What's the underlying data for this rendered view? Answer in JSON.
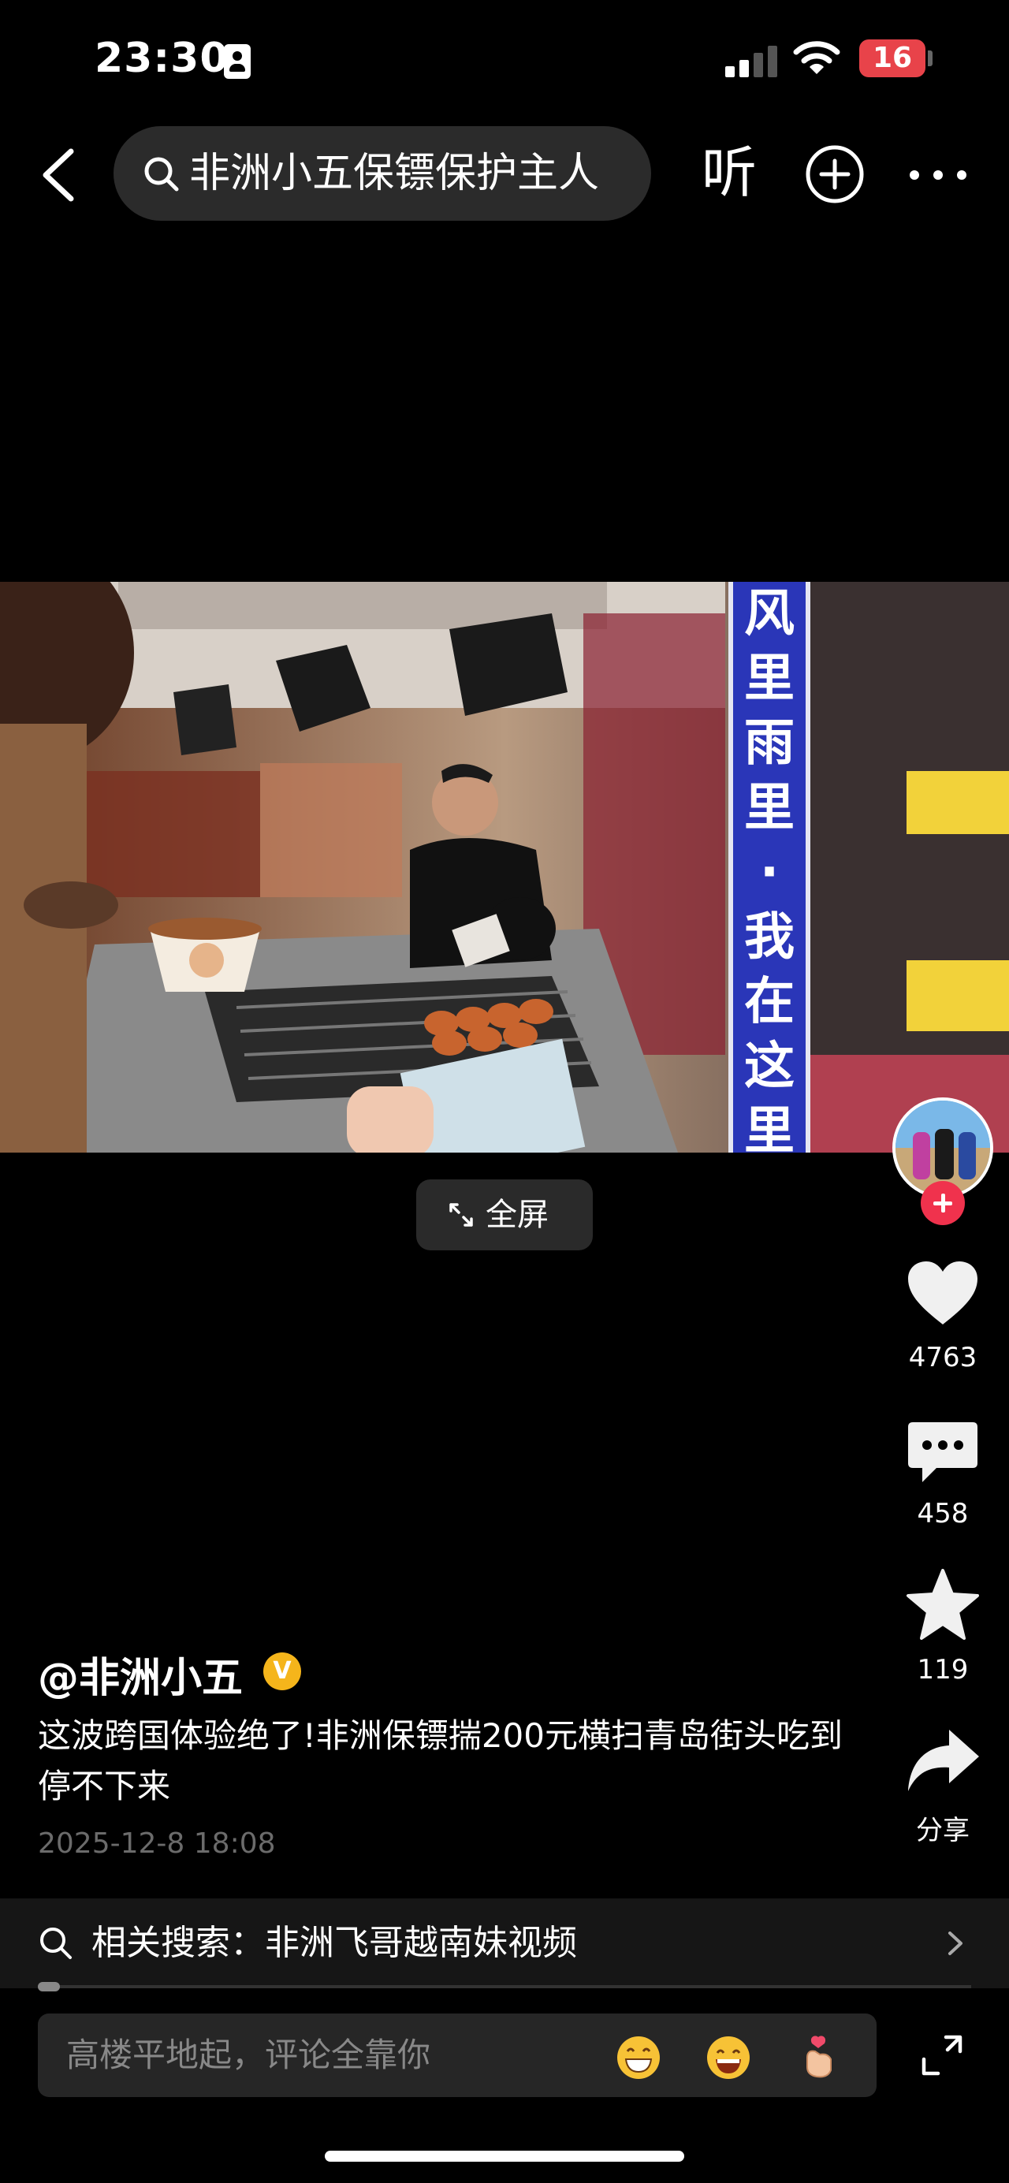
{
  "status_bar": {
    "time": "23:30",
    "battery": "16"
  },
  "top_bar": {
    "search_text": "非洲小五保镖保护主人",
    "listen_label": "听"
  },
  "video": {
    "fullscreen_label": "全屏",
    "sign_text": "风里雨里·我在这里等"
  },
  "actions": {
    "likes": "4763",
    "comments": "458",
    "favorites": "119",
    "share_label": "分享"
  },
  "post": {
    "author": "@非洲小五",
    "verified_badge": "V",
    "description": "这波跨国体验绝了!非洲保镖揣200元横扫青岛街头吃到停不下来",
    "date": "2025-12-8 18:08"
  },
  "related": {
    "label": "相关搜索：非洲飞哥越南妹视频"
  },
  "comment_bar": {
    "placeholder": "高楼平地起，评论全靠你"
  }
}
